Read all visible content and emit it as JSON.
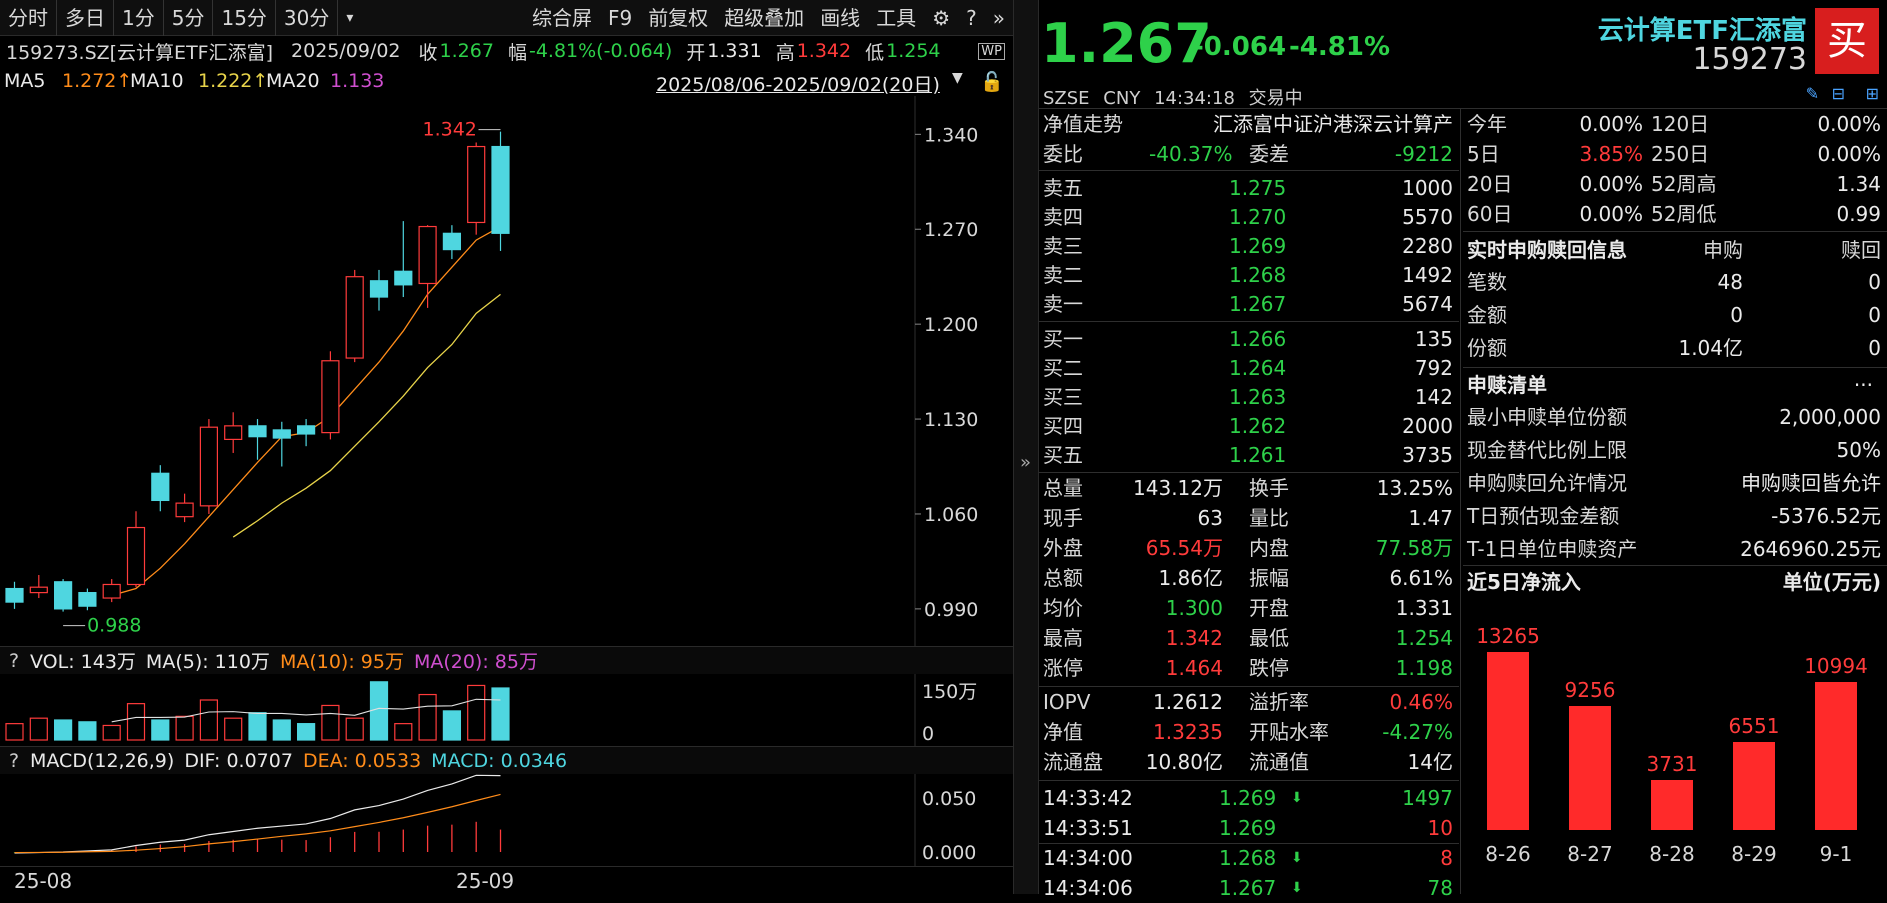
{
  "toolbar": {
    "items": [
      "分时",
      "多日",
      "1分",
      "5分",
      "15分",
      "30分",
      "▾"
    ],
    "right_items": [
      "综合屏",
      "F9",
      "前复权",
      "超级叠加",
      "画线",
      "工具"
    ]
  },
  "info": {
    "code": "159273.SZ[云计算ETF汇添富]",
    "date": "2025/09/02",
    "close_label": "收",
    "close": "1.267",
    "change_label": "幅",
    "change": "-4.81%(-0.064)",
    "open_label": "开",
    "open": "1.331",
    "high_label": "高",
    "high": "1.342",
    "low_label": "低",
    "low": "1.254"
  },
  "ma": {
    "ma5_label": "MA5",
    "ma5": "1.272↑",
    "ma10_label": "MA10",
    "ma10": "1.222↑",
    "ma20_label": "MA20",
    "ma20": "1.133",
    "range": "2025/08/06-2025/09/02(20日)"
  },
  "kline": {
    "y_ticks": [
      "1.340",
      "1.270",
      "1.200",
      "1.130",
      "1.060",
      "0.990"
    ],
    "high_marker": "1.342",
    "low_marker": "0.988",
    "candles": [
      {
        "o": 1.005,
        "c": 0.995,
        "h": 1.01,
        "l": 0.99
      },
      {
        "o": 1.002,
        "c": 1.006,
        "h": 1.015,
        "l": 0.998
      },
      {
        "o": 1.01,
        "c": 0.99,
        "h": 1.012,
        "l": 0.988
      },
      {
        "o": 1.002,
        "c": 0.992,
        "h": 1.005,
        "l": 0.989
      },
      {
        "o": 0.998,
        "c": 1.008,
        "h": 1.012,
        "l": 0.995
      },
      {
        "o": 1.008,
        "c": 1.05,
        "h": 1.062,
        "l": 1.006
      },
      {
        "o": 1.09,
        "c": 1.07,
        "h": 1.096,
        "l": 1.062
      },
      {
        "o": 1.058,
        "c": 1.068,
        "h": 1.075,
        "l": 1.054
      },
      {
        "o": 1.066,
        "c": 1.124,
        "h": 1.13,
        "l": 1.06
      },
      {
        "o": 1.115,
        "c": 1.125,
        "h": 1.135,
        "l": 1.105
      },
      {
        "o": 1.125,
        "c": 1.117,
        "h": 1.13,
        "l": 1.1
      },
      {
        "o": 1.122,
        "c": 1.116,
        "h": 1.128,
        "l": 1.095
      },
      {
        "o": 1.125,
        "c": 1.119,
        "h": 1.13,
        "l": 1.11
      },
      {
        "o": 1.12,
        "c": 1.173,
        "h": 1.18,
        "l": 1.115
      },
      {
        "o": 1.175,
        "c": 1.235,
        "h": 1.24,
        "l": 1.172
      },
      {
        "o": 1.232,
        "c": 1.22,
        "h": 1.24,
        "l": 1.21
      },
      {
        "o": 1.239,
        "c": 1.229,
        "h": 1.276,
        "l": 1.22
      },
      {
        "o": 1.23,
        "c": 1.272,
        "h": 1.273,
        "l": 1.212
      },
      {
        "o": 1.267,
        "c": 1.255,
        "h": 1.273,
        "l": 1.248
      },
      {
        "o": 1.275,
        "c": 1.331,
        "h": 1.334,
        "l": 1.266
      },
      {
        "o": 1.331,
        "c": 1.267,
        "h": 1.342,
        "l": 1.254
      }
    ],
    "ma5": [
      null,
      null,
      null,
      null,
      1.0,
      1.005,
      1.02,
      1.038,
      1.058,
      1.078,
      1.098,
      1.117,
      1.12,
      1.132,
      1.152,
      1.172,
      1.195,
      1.222,
      1.242,
      1.262,
      1.272
    ],
    "ma10": [
      null,
      null,
      null,
      null,
      null,
      null,
      null,
      null,
      null,
      1.043,
      1.055,
      1.068,
      1.079,
      1.092,
      1.11,
      1.128,
      1.147,
      1.168,
      1.185,
      1.208,
      1.222
    ]
  },
  "vol": {
    "label": "VOL: 143万",
    "ma5": "MA(5): 110万",
    "ma10": "MA(10): 95万",
    "ma20": "MA(20): 85万",
    "y_top": "150万",
    "y_zero": "0",
    "values": [
      45,
      60,
      55,
      50,
      40,
      100,
      55,
      65,
      110,
      60,
      75,
      55,
      45,
      95,
      60,
      160,
      45,
      125,
      80,
      150,
      143
    ],
    "up": [
      true,
      true,
      false,
      false,
      true,
      true,
      false,
      true,
      true,
      true,
      false,
      false,
      false,
      true,
      true,
      false,
      true,
      true,
      false,
      true,
      false
    ],
    "ma_line": [
      null,
      null,
      null,
      null,
      50,
      62,
      62,
      63,
      77,
      78,
      73,
      73,
      69,
      73,
      68,
      87,
      85,
      93,
      94,
      112,
      110
    ]
  },
  "macd": {
    "label": "MACD(12,26,9)",
    "dif": "DIF: 0.0707",
    "dea": "DEA: 0.0533",
    "macd": "MACD: 0.0346",
    "y_ticks": [
      "0.050",
      "0.000"
    ],
    "dif_vals": [
      -0.001,
      -0.0005,
      0.0,
      0.001,
      0.002,
      0.006,
      0.009,
      0.011,
      0.016,
      0.019,
      0.022,
      0.024,
      0.026,
      0.031,
      0.039,
      0.043,
      0.049,
      0.057,
      0.063,
      0.071,
      0.0707
    ],
    "dea_vals": [
      -0.0005,
      -0.0004,
      -0.0002,
      0.0002,
      0.0006,
      0.0017,
      0.0032,
      0.0049,
      0.0075,
      0.0096,
      0.012,
      0.0145,
      0.0168,
      0.0196,
      0.0235,
      0.0274,
      0.0317,
      0.0367,
      0.0419,
      0.0477,
      0.0533
    ],
    "bars": [
      -0.001,
      -0.0002,
      0.0004,
      0.0016,
      0.0028,
      0.0086,
      0.0116,
      0.0122,
      0.017,
      0.0188,
      0.02,
      0.019,
      0.0184,
      0.0228,
      0.031,
      0.0312,
      0.0346,
      0.0406,
      0.0422,
      0.0466,
      0.0346
    ]
  },
  "x_labels": [
    "25-08",
    "25-09"
  ],
  "quote": {
    "price": "1.267",
    "change": "-0.064",
    "pct": "-4.81%",
    "name": "云计算ETF汇添富",
    "code": "159273",
    "buy_btn": "买",
    "exchange": "SZSE",
    "currency": "CNY",
    "time": "14:34:18",
    "status": "交易中"
  },
  "orderbook": {
    "nav_label": "净值走势",
    "index_name": "汇添富中证沪港深云计算产",
    "weibi_label": "委比",
    "weibi": "-40.37%",
    "weicha_label": "委差",
    "weicha": "-9212",
    "asks": [
      {
        "label": "卖五",
        "price": "1.275",
        "vol": "1000"
      },
      {
        "label": "卖四",
        "price": "1.270",
        "vol": "5570"
      },
      {
        "label": "卖三",
        "price": "1.269",
        "vol": "2280"
      },
      {
        "label": "卖二",
        "price": "1.268",
        "vol": "1492"
      },
      {
        "label": "卖一",
        "price": "1.267",
        "vol": "5674"
      }
    ],
    "bids": [
      {
        "label": "买一",
        "price": "1.266",
        "vol": "135"
      },
      {
        "label": "买二",
        "price": "1.264",
        "vol": "792"
      },
      {
        "label": "买三",
        "price": "1.263",
        "vol": "142"
      },
      {
        "label": "买四",
        "price": "1.262",
        "vol": "2000"
      },
      {
        "label": "买五",
        "price": "1.261",
        "vol": "3735"
      }
    ]
  },
  "stats": [
    [
      {
        "l": "总量",
        "v": "143.12万",
        "c": "white"
      },
      {
        "l": "换手",
        "v": "13.25%",
        "c": "white"
      }
    ],
    [
      {
        "l": "现手",
        "v": "63",
        "c": "white"
      },
      {
        "l": "量比",
        "v": "1.47",
        "c": "white"
      }
    ],
    [
      {
        "l": "外盘",
        "v": "65.54万",
        "c": "red"
      },
      {
        "l": "内盘",
        "v": "77.58万",
        "c": "green"
      }
    ],
    [
      {
        "l": "总额",
        "v": "1.86亿",
        "c": "white"
      },
      {
        "l": "振幅",
        "v": "6.61%",
        "c": "white"
      }
    ],
    [
      {
        "l": "均价",
        "v": "1.300",
        "c": "green"
      },
      {
        "l": "开盘",
        "v": "1.331",
        "c": "white"
      }
    ],
    [
      {
        "l": "最高",
        "v": "1.342",
        "c": "red"
      },
      {
        "l": "最低",
        "v": "1.254",
        "c": "green"
      }
    ],
    [
      {
        "l": "涨停",
        "v": "1.464",
        "c": "red"
      },
      {
        "l": "跌停",
        "v": "1.198",
        "c": "green"
      }
    ]
  ],
  "stats2": [
    [
      {
        "l": "IOPV",
        "v": "1.2612",
        "c": "white"
      },
      {
        "l": "溢折率",
        "v": "0.46%",
        "c": "red"
      }
    ],
    [
      {
        "l": "净值",
        "v": "1.3235",
        "c": "red"
      },
      {
        "l": "开贴水率",
        "v": "-4.27%",
        "c": "green"
      }
    ],
    [
      {
        "l": "流通盘",
        "v": "10.80亿",
        "c": "white"
      },
      {
        "l": "流通值",
        "v": "14亿",
        "c": "white"
      }
    ]
  ],
  "ticks": [
    {
      "t": "14:33:42",
      "p": "1.269",
      "arrow": "down",
      "v": "1497",
      "vc": "green"
    },
    {
      "t": "14:33:51",
      "p": "1.269",
      "arrow": "",
      "v": "10",
      "vc": "red"
    },
    {
      "t": "14:34:00",
      "p": "1.268",
      "arrow": "down",
      "v": "8",
      "vc": "red"
    },
    {
      "t": "14:34:06",
      "p": "1.267",
      "arrow": "down",
      "v": "78",
      "vc": "green"
    }
  ],
  "perf": [
    {
      "l1": "今年",
      "v1": "0.00%",
      "c1": "white",
      "l2": "120日",
      "v2": "0.00%"
    },
    {
      "l1": "5日",
      "v1": "3.85%",
      "c1": "red",
      "l2": "250日",
      "v2": "0.00%"
    },
    {
      "l1": "20日",
      "v1": "0.00%",
      "c1": "white",
      "l2": "52周高",
      "v2": "1.34"
    },
    {
      "l1": "60日",
      "v1": "0.00%",
      "c1": "white",
      "l2": "52周低",
      "v2": "0.99"
    }
  ],
  "subscribe": {
    "title": "实时申购赎回信息",
    "col1": "申购",
    "col2": "赎回",
    "rows": [
      {
        "l": "笔数",
        "a": "48",
        "b": "0"
      },
      {
        "l": "金额",
        "a": "0",
        "b": "0"
      },
      {
        "l": "份额",
        "a": "1.04亿",
        "b": "0"
      }
    ]
  },
  "list": {
    "title": "申赎清单",
    "more": "···",
    "rows": [
      {
        "l": "最小申赎单位份额",
        "v": "2,000,000"
      },
      {
        "l": "现金替代比例上限",
        "v": "50%"
      },
      {
        "l": "申购赎回允许情况",
        "v": "申购赎回皆允许"
      },
      {
        "l": "T日预估现金差额",
        "v": "-5376.52元"
      },
      {
        "l": "T-1日单位申赎资产",
        "v": "2646960.25元"
      }
    ]
  },
  "chart_data": {
    "type": "bar",
    "title": "近5日净流入",
    "unit_label": "单位(万元)",
    "categories": [
      "8-26",
      "8-27",
      "8-28",
      "8-29",
      "9-1"
    ],
    "values": [
      13265,
      9256,
      3731,
      6551,
      10994
    ],
    "ylim": [
      0,
      14000
    ],
    "color": "#ff2a2a"
  }
}
